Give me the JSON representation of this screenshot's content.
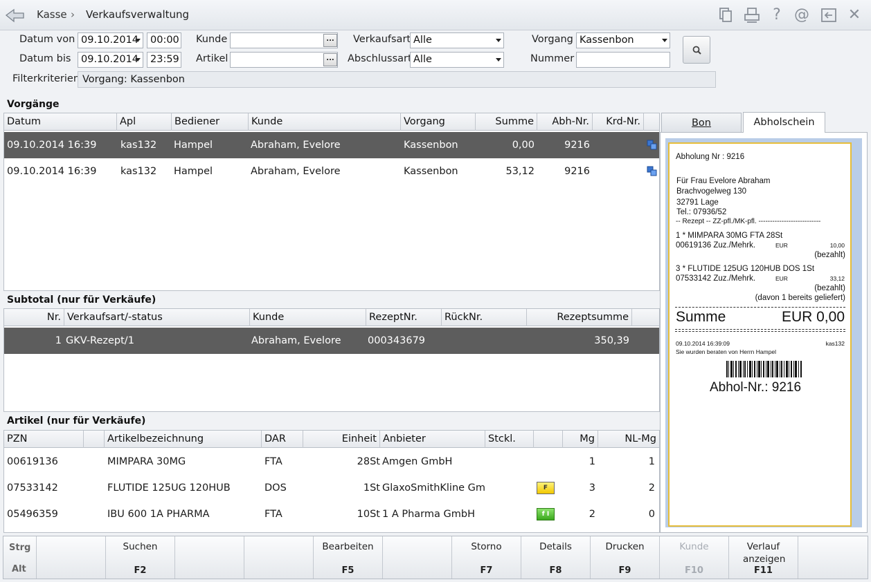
{
  "breadcrumb": {
    "root": "Kasse",
    "sep": "›",
    "page": "Verkaufsverwaltung"
  },
  "filters": {
    "datum_von_label": "Datum von",
    "datum_von": "09.10.2014",
    "zeit_von": "00:00",
    "datum_bis_label": "Datum bis",
    "datum_bis": "09.10.2014",
    "zeit_bis": "23:59",
    "kunde_label": "Kunde",
    "kunde": "",
    "artikel_label": "Artikel",
    "artikel": "",
    "verkaufsart_label": "Verkaufsart",
    "verkaufsart": "Alle",
    "abschlussart_label": "Abschlussart",
    "abschlussart": "Alle",
    "vorgang_label": "Vorgang",
    "vorgang": "Kassenbon",
    "nummer_label": "Nummer",
    "nummer": "",
    "kriterien_label": "Filterkriterien",
    "kriterien": "Vorgang: Kassenbon",
    "dots": "..."
  },
  "vorgaenge": {
    "title": "Vorgänge",
    "columns": [
      "Datum",
      "Apl",
      "Bediener",
      "Kunde",
      "Vorgang",
      "Summe",
      "Abh-Nr.",
      "Krd-Nr."
    ],
    "rows": [
      {
        "datum": "09.10.2014 16:39",
        "apl": "kas132",
        "bediener": "Hampel",
        "kunde": "Abraham, Evelore",
        "vorgang": "Kassenbon",
        "summe": "0,00",
        "abh": "9216",
        "krd": ""
      },
      {
        "datum": "09.10.2014 16:39",
        "apl": "kas132",
        "bediener": "Hampel",
        "kunde": "Abraham, Evelore",
        "vorgang": "Kassenbon",
        "summe": "53,12",
        "abh": "9216",
        "krd": ""
      }
    ]
  },
  "subtotal": {
    "title": "Subtotal (nur für Verkäufe)",
    "columns": [
      "Nr.",
      "Verkaufsart/-status",
      "Kunde",
      "RezeptNr.",
      "RückNr.",
      "Rezeptsumme"
    ],
    "rows": [
      {
        "nr": "1",
        "art": "GKV-Rezept/1",
        "kunde": "Abraham, Evelore",
        "rezept": "000343679",
        "rueck": "",
        "summe": "350,39"
      }
    ]
  },
  "artikel": {
    "title": "Artikel (nur für Verkäufe)",
    "columns": [
      "PZN",
      "",
      "Artikelbezeichnung",
      "DAR",
      "Einheit",
      "Anbieter",
      "Stckl.",
      "",
      "Mg",
      "NL-Mg"
    ],
    "rows": [
      {
        "pzn": "00619136",
        "bez": "MIMPARA 30MG",
        "dar": "FTA",
        "einheit": "28St",
        "anbieter": "Amgen GmbH",
        "badge": "",
        "mg": "1",
        "nlmg": "1"
      },
      {
        "pzn": "07533142",
        "bez": "FLUTIDE 125UG 120HUB",
        "dar": "DOS",
        "einheit": "1St",
        "anbieter": "GlaxoSmithKline Gmb",
        "badge": "F",
        "mg": "3",
        "nlmg": "2"
      },
      {
        "pzn": "05496359",
        "bez": "IBU 600 1A PHARMA",
        "dar": "FTA",
        "einheit": "10St",
        "anbieter": "1 A Pharma GmbH",
        "badge": "f I",
        "mg": "2",
        "nlmg": "0"
      }
    ]
  },
  "tabs": {
    "bon": "Bon",
    "abhol": "Abholschein"
  },
  "receipt": {
    "header": "Abholung Nr : 9216",
    "name": "Für Frau Evelore Abraham",
    "street": "Brachvogelweg 130",
    "city": "32791 Lage",
    "tel": "Tel.: 07936/52",
    "section": "-- Rezept -- ZZ-pfl./MK-pfl. ---------------------------",
    "item1_line1": "1 * MIMPARA 30MG FTA 28St",
    "item1_pzn": "00619136  Zuz./Mehrk.",
    "item1_cur": "EUR",
    "item1_val": "10,00",
    "item1_paid": "(bezahlt)",
    "item2_line1": "3 * FLUTIDE 125UG 120HUB DOS 1St",
    "item2_pzn": "07533142  Zuz./Mehrk.",
    "item2_cur": "EUR",
    "item2_val": "33,12",
    "item2_paid": "(bezahlt)",
    "item2_note": "(davon 1 bereits geliefert)",
    "summe_label": "Summe",
    "summe_val": "EUR  0,00",
    "footer_date": "09.10.2014 16:39:09",
    "footer_apl": "kas132",
    "footer_beraten": "Sie wurden beraten von Herrn Hampel",
    "abhol_nr": "Abhol-Nr.: 9216"
  },
  "modkeys": {
    "strg": "Strg",
    "alt": "Alt"
  },
  "fkeys": [
    {
      "label": "",
      "key": ""
    },
    {
      "label": "Suchen",
      "key": "F2"
    },
    {
      "label": "",
      "key": ""
    },
    {
      "label": "",
      "key": ""
    },
    {
      "label": "Bearbeiten",
      "key": "F5"
    },
    {
      "label": "",
      "key": ""
    },
    {
      "label": "Storno",
      "key": "F7"
    },
    {
      "label": "Details",
      "key": "F8"
    },
    {
      "label": "Drucken",
      "key": "F9"
    },
    {
      "label": "Kunde",
      "key": "F10"
    },
    {
      "label": "Verlauf anzeigen",
      "key": "F11"
    },
    {
      "label": "",
      "key": ""
    }
  ],
  "colors": {
    "selected_row": "#5d5d5d",
    "receipt_border": "#e6bd39",
    "receipt_bg": "#b9cde8"
  }
}
